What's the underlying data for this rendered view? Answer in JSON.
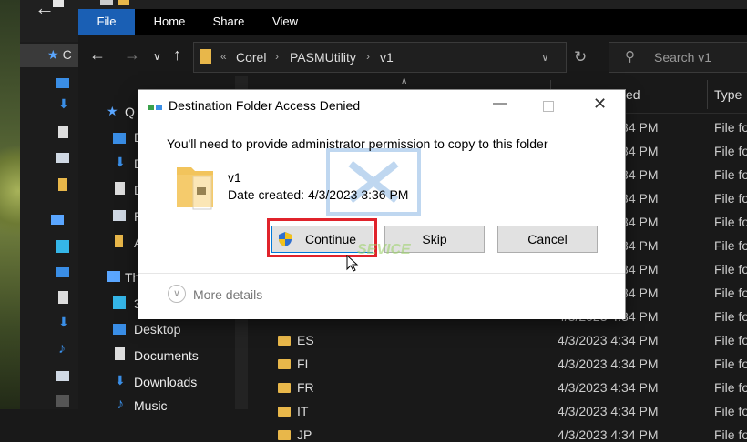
{
  "ribbon": {
    "tabs": [
      "File",
      "Home",
      "Share",
      "View"
    ]
  },
  "address": {
    "crumbs": [
      "Corel",
      "PASMUtility",
      "v1"
    ],
    "overflow": "«"
  },
  "search": {
    "placeholder": "Search v1"
  },
  "back_window": {
    "title_letter": "C",
    "items_letters": [
      "C",
      "D",
      "D",
      "D",
      "F",
      "A",
      "T",
      "3"
    ]
  },
  "navpane": {
    "quick_access_prefix": "Q",
    "this_pc_prefix": "Th",
    "items_partial": [
      "D",
      "D",
      "D",
      "P",
      "A"
    ],
    "items": [
      "Desktop",
      "Documents",
      "Downloads",
      "Music"
    ]
  },
  "columns": {
    "date_modified_suffix": "ed",
    "type": "Type"
  },
  "rows": [
    {
      "name": "",
      "date": "4/3/2023 4:34 PM",
      "type": "File fo"
    },
    {
      "name": "",
      "date": "4/3/2023 4:34 PM",
      "type": "File fo"
    },
    {
      "name": "",
      "date": "4/3/2023 4:34 PM",
      "type": "File fo"
    },
    {
      "name": "",
      "date": "4/3/2023 4:34 PM",
      "type": "File fo"
    },
    {
      "name": "",
      "date": "4/3/2023 4:34 PM",
      "type": "File fo"
    },
    {
      "name": "",
      "date": "4/3/2023 4:34 PM",
      "type": "File fo"
    },
    {
      "name": "",
      "date": "4/3/2023 4:34 PM",
      "type": "File fo"
    },
    {
      "name": "",
      "date": "4/3/2023 4:34 PM",
      "type": "File fo"
    },
    {
      "name": "",
      "date": "4/3/2023 4:34 PM",
      "type": "File fo"
    },
    {
      "name": "ES",
      "date": "4/3/2023 4:34 PM",
      "type": "File fo"
    },
    {
      "name": "FI",
      "date": "4/3/2023 4:34 PM",
      "type": "File fo"
    },
    {
      "name": "FR",
      "date": "4/3/2023 4:34 PM",
      "type": "File fo"
    },
    {
      "name": "IT",
      "date": "4/3/2023 4:34 PM",
      "type": "File fo"
    },
    {
      "name": "JP",
      "date": "4/3/2023 4:34 PM",
      "type": "File fo"
    }
  ],
  "dialog": {
    "title": "Destination Folder Access Denied",
    "message": "You'll need to provide administrator permission to copy to this folder",
    "file_name": "v1",
    "file_date": "Date created: 4/3/2023 3:36 PM",
    "continue_label": "Continue",
    "skip_label": "Skip",
    "cancel_label": "Cancel",
    "more_details": "More details"
  },
  "watermark": {
    "text": "SEVICE"
  },
  "colors": {
    "accent": "#1a5fb4",
    "highlight": "#e0232b",
    "folder": "#e8b74a"
  }
}
